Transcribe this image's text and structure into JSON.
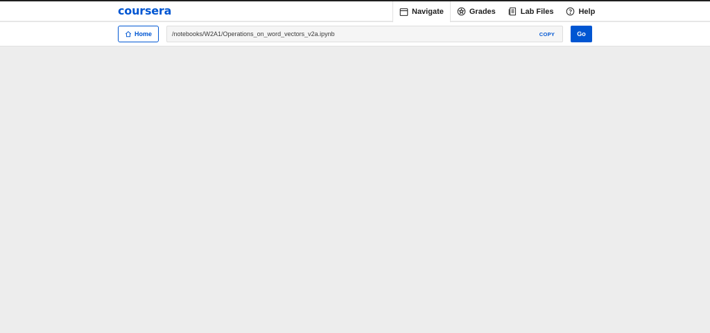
{
  "header": {
    "logo_text": "coursera",
    "nav": [
      {
        "label": "Navigate",
        "icon": "window-icon"
      },
      {
        "label": "Grades",
        "icon": "star-badge-icon"
      },
      {
        "label": "Lab Files",
        "icon": "file-icon"
      },
      {
        "label": "Help",
        "icon": "help-icon"
      }
    ]
  },
  "toolbar": {
    "home_label": "Home",
    "path_value": "/notebooks/W2A1/Operations_on_word_vectors_v2a.ipynb",
    "copy_label": "COPY",
    "go_label": "Go"
  },
  "colors": {
    "brand": "#0056d2",
    "background": "#ededed",
    "header_bg": "#ffffff"
  }
}
